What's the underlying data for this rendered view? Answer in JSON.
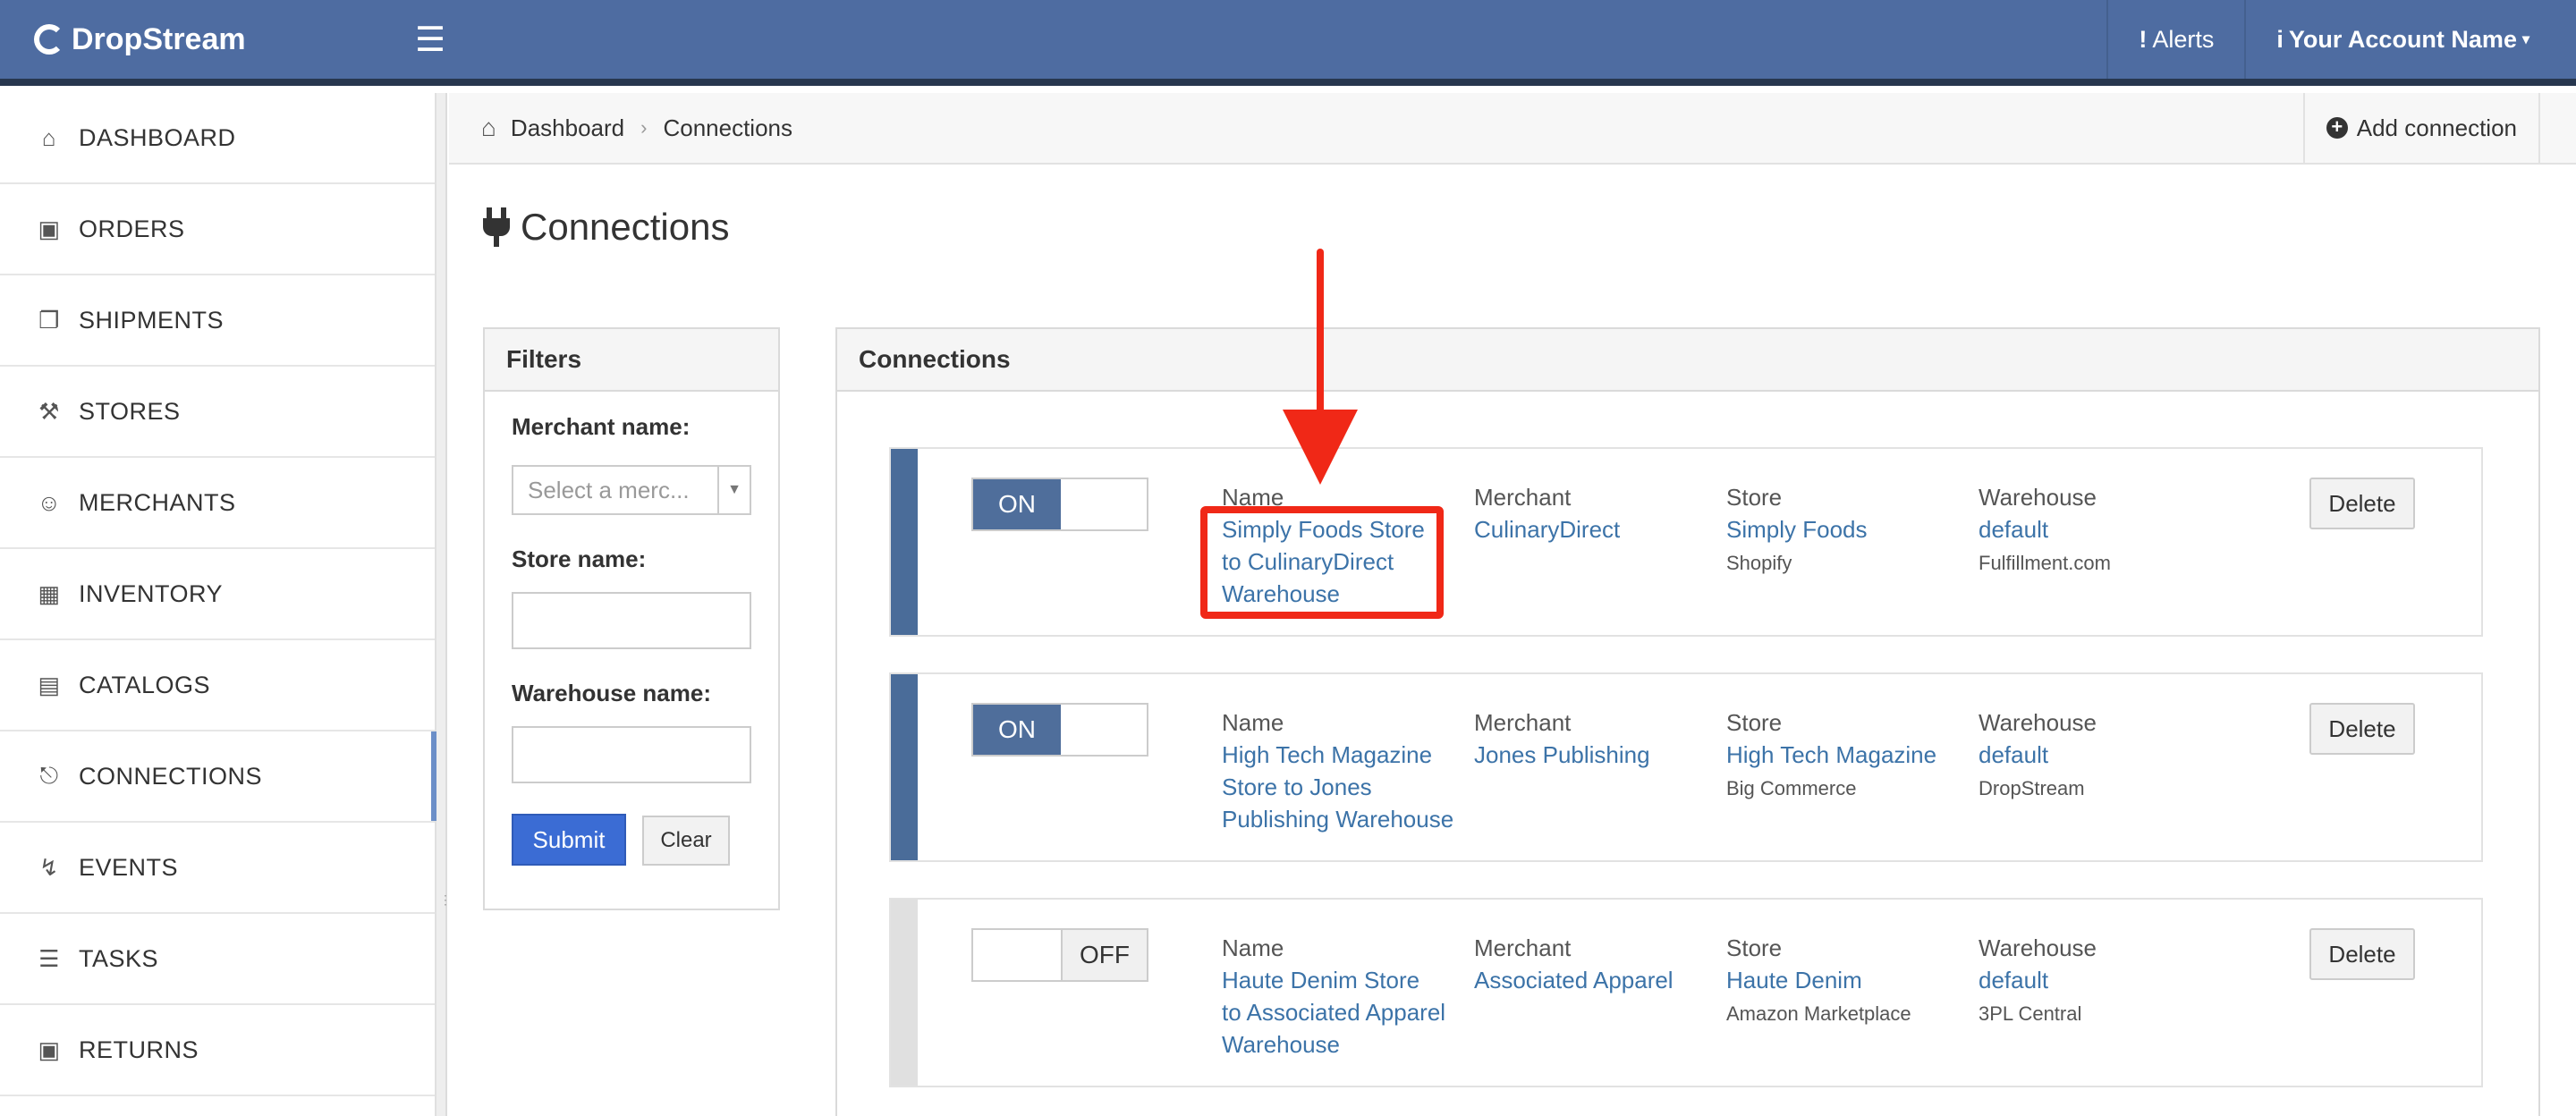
{
  "topbar": {
    "brand": "DropStream",
    "alerts_label": "Alerts",
    "alerts_glyph": "!",
    "account_label": "Your Account Name",
    "account_glyph": "i"
  },
  "sidebar": {
    "items": [
      {
        "label": "DASHBOARD",
        "icon": "home-icon"
      },
      {
        "label": "ORDERS",
        "icon": "bag-icon"
      },
      {
        "label": "SHIPMENTS",
        "icon": "gift-box-icon"
      },
      {
        "label": "STORES",
        "icon": "cart-icon"
      },
      {
        "label": "MERCHANTS",
        "icon": "users-icon"
      },
      {
        "label": "INVENTORY",
        "icon": "warehouse-icon"
      },
      {
        "label": "CATALOGS",
        "icon": "book-icon"
      },
      {
        "label": "CONNECTIONS",
        "icon": "plug-icon",
        "active": true
      },
      {
        "label": "EVENTS",
        "icon": "bolt-icon"
      },
      {
        "label": "TASKS",
        "icon": "list-icon"
      },
      {
        "label": "RETURNS",
        "icon": "bag-icon"
      }
    ]
  },
  "breadcrumb": {
    "home": "Dashboard",
    "current": "Connections"
  },
  "header_actions": {
    "add_connection": "Add connection"
  },
  "page": {
    "title": "Connections"
  },
  "filters": {
    "title": "Filters",
    "merchant_label": "Merchant name:",
    "merchant_placeholder": "Select a merc...",
    "store_label": "Store name:",
    "store_value": "",
    "warehouse_label": "Warehouse name:",
    "warehouse_value": "",
    "submit_label": "Submit",
    "clear_label": "Clear"
  },
  "connections": {
    "title": "Connections",
    "column_headers": {
      "name": "Name",
      "merchant": "Merchant",
      "store": "Store",
      "warehouse": "Warehouse"
    },
    "delete_label": "Delete",
    "on_label": "ON",
    "off_label": "OFF",
    "rows": [
      {
        "enabled": true,
        "name_lines": [
          "Simply Foods Store",
          "to CulinaryDirect",
          "Warehouse"
        ],
        "merchant": "CulinaryDirect",
        "store": "Simply Foods",
        "store_platform": "Shopify",
        "warehouse": "default",
        "warehouse_provider": "Fulfillment.com"
      },
      {
        "enabled": true,
        "name_lines": [
          "High Tech Magazine",
          "Store to Jones",
          "Publishing Warehouse"
        ],
        "merchant": "Jones Publishing",
        "store": "High Tech Magazine",
        "store_platform": "Big Commerce",
        "warehouse": "default",
        "warehouse_provider": "DropStream"
      },
      {
        "enabled": false,
        "name_lines": [
          "Haute Denim Store",
          "to Associated Apparel",
          "Warehouse"
        ],
        "merchant": "Associated Apparel",
        "store": "Haute Denim",
        "store_platform": "Amazon Marketplace",
        "warehouse": "default",
        "warehouse_provider": "3PL Central"
      }
    ]
  },
  "colors": {
    "topbar": "#4e6ca1",
    "topbar_border": "#27374f",
    "enabled_bar": "#4a6c99",
    "disabled_bar": "#e0e0e0",
    "link": "#3c73a8",
    "submit": "#3b6cd4",
    "annotation": "#f02817"
  }
}
